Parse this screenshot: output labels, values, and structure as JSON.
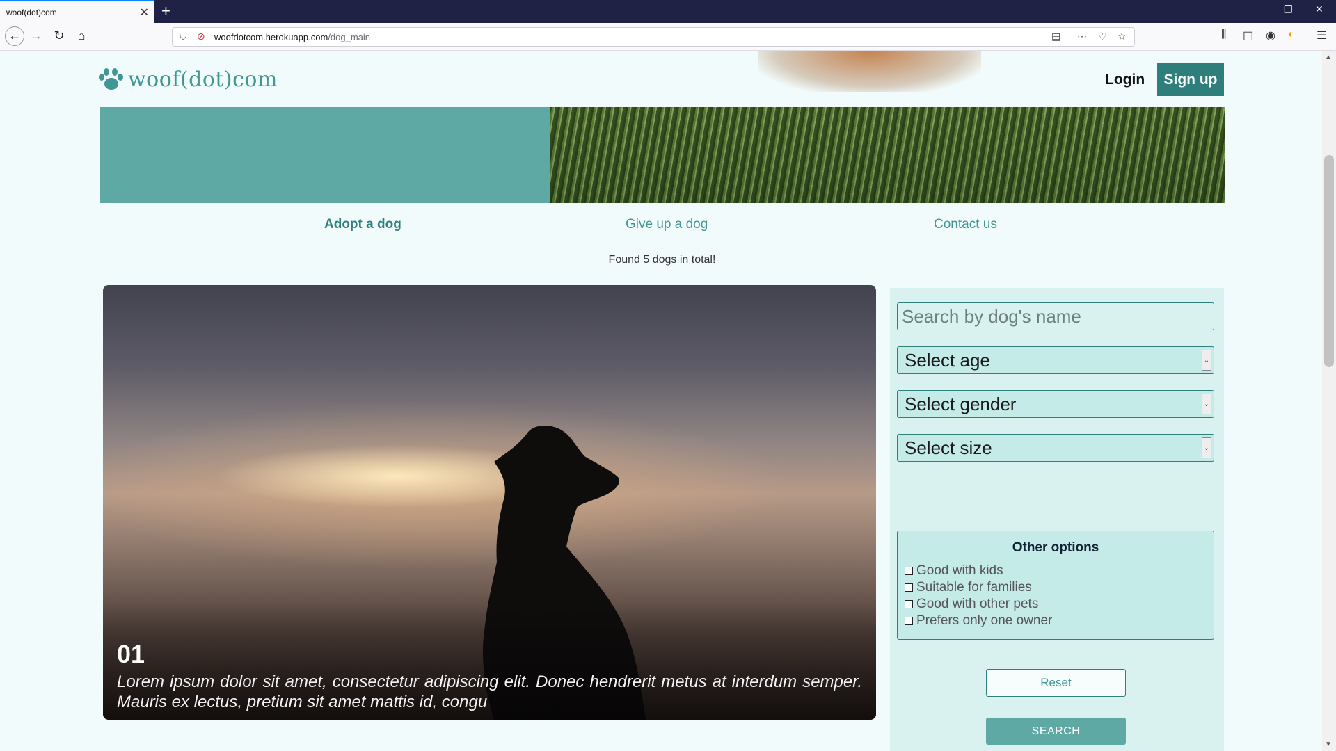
{
  "browser": {
    "tab_title": "woof(dot)com",
    "url_host": "woofdotcom.herokuapp.com",
    "url_path": "/dog_main"
  },
  "header": {
    "logo_text": "woof(dot)com",
    "login": "Login",
    "signup": "Sign up"
  },
  "nav": {
    "adopt": "Adopt a dog",
    "give": "Give up a dog",
    "contact": "Contact us"
  },
  "results": {
    "found_text": "Found 5 dogs in total!"
  },
  "card": {
    "number": "01",
    "description": "Lorem ipsum dolor sit amet, consectetur adipiscing elit. Donec hendrerit metus at interdum semper. Mauris ex lectus, pretium sit amet mattis id, congu"
  },
  "filters": {
    "name_placeholder": "Search by dog's name",
    "age": "Select age",
    "gender": "Select gender",
    "size": "Select size",
    "other_title": "Other options",
    "options": [
      "Good with kids",
      "Suitable for families",
      "Good with other pets",
      "Prefers only one owner"
    ],
    "reset": "Reset",
    "search": "SEARCH"
  },
  "colors": {
    "teal": "#3f9693",
    "teal_dark": "#2e7f7c",
    "banner_teal": "#5fa9a5",
    "page_bg": "#f1fbfb"
  }
}
